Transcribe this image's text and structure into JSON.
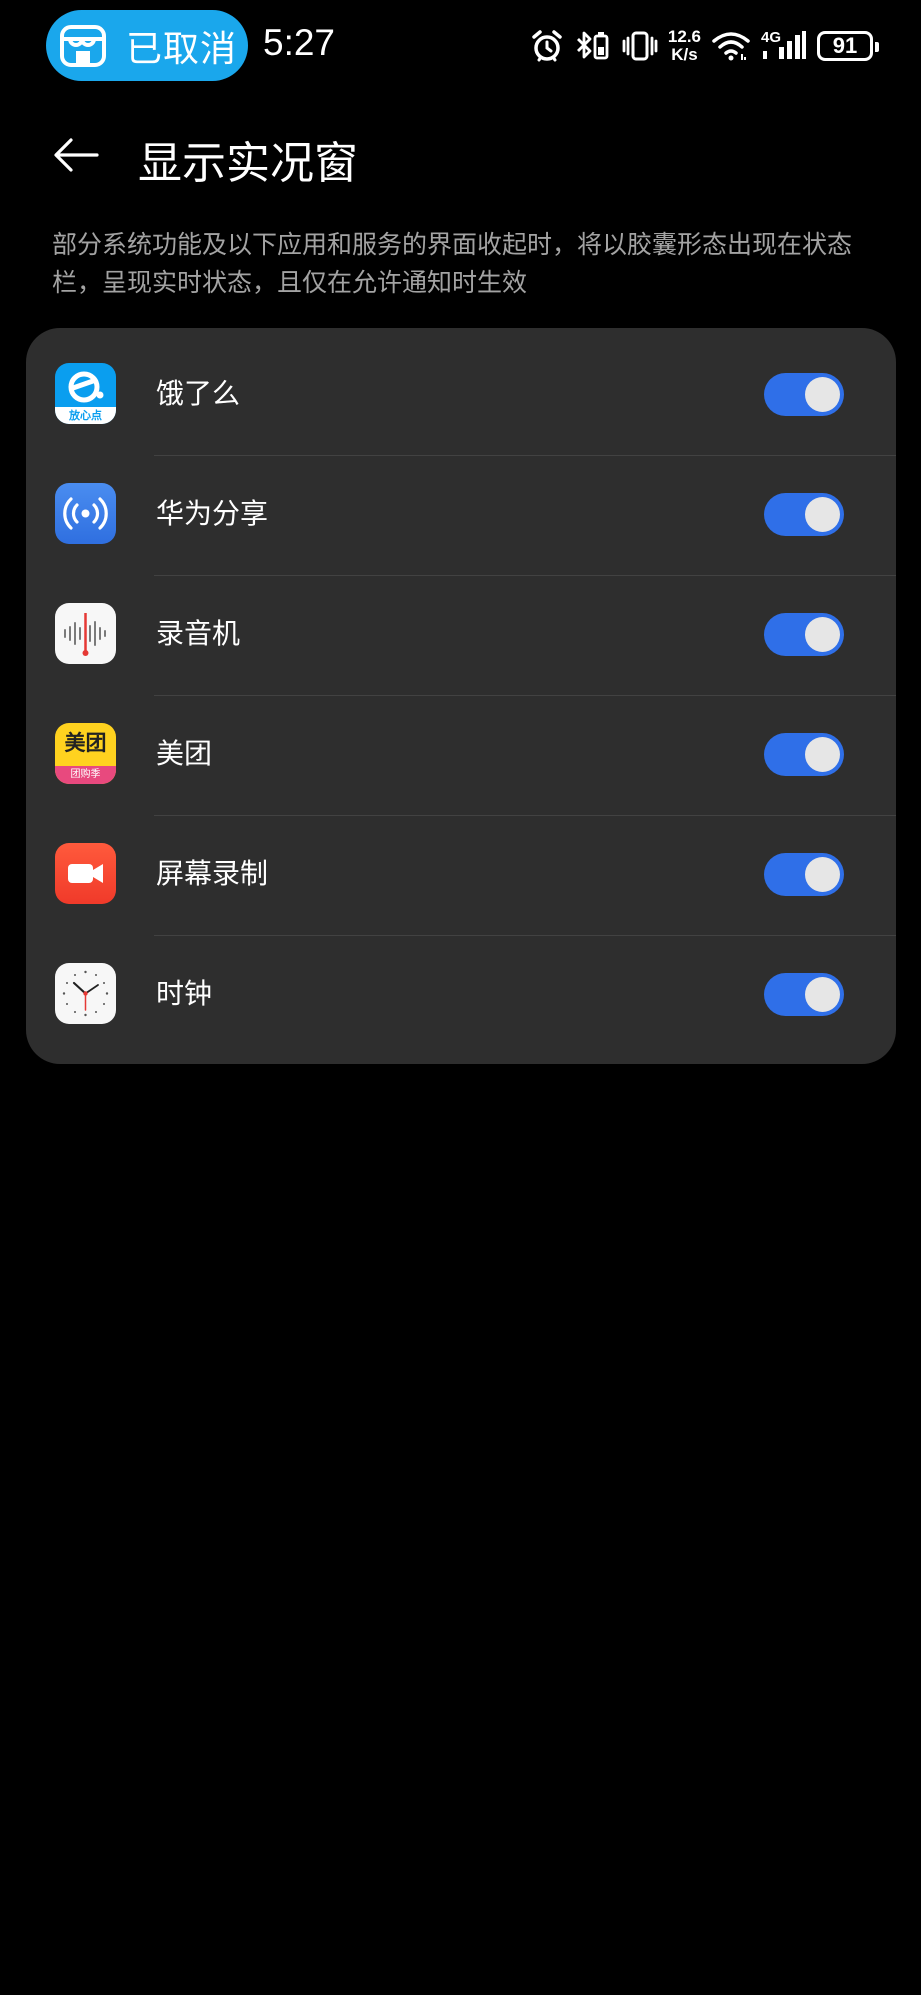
{
  "status_bar": {
    "capsule_label": "已取消",
    "time": "5:27",
    "net_speed_value": "12.6",
    "net_speed_unit": "K/s",
    "network_type": "4G",
    "battery_level": "91",
    "icons": [
      "alarm-icon",
      "bluetooth-battery-icon",
      "vibrate-icon",
      "wifi-icon",
      "cellular-signal-icon",
      "battery-icon"
    ]
  },
  "header": {
    "title": "显示实况窗"
  },
  "description": "部分系统功能及以下应用和服务的界面收起时，将以胶囊形态出现在状态栏，呈现实时状态，且仅在允许通知时生效",
  "apps": [
    {
      "name": "饿了么",
      "icon": "eleme-icon",
      "icon_text": "放心点",
      "enabled": true
    },
    {
      "name": "华为分享",
      "icon": "huawei-share-icon",
      "enabled": true
    },
    {
      "name": "录音机",
      "icon": "recorder-icon",
      "enabled": true
    },
    {
      "name": "美团",
      "icon": "meituan-icon",
      "icon_text": "美团",
      "icon_subtext": "团购季",
      "enabled": true
    },
    {
      "name": "屏幕录制",
      "icon": "screen-record-icon",
      "enabled": true
    },
    {
      "name": "时钟",
      "icon": "clock-app-icon",
      "enabled": true
    }
  ],
  "colors": {
    "background": "#000000",
    "card": "#2e2e2e",
    "toggle_on": "#2f6fe8",
    "capsule": "#1aa7ec",
    "secondary_text": "#a3a3a3"
  }
}
